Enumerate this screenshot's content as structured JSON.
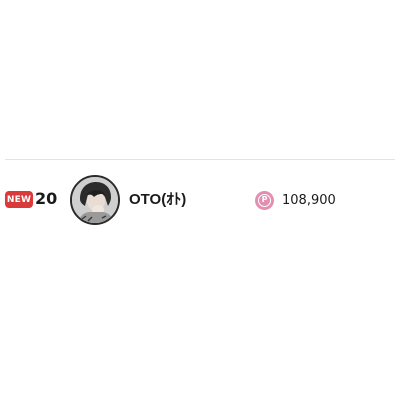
{
  "ranking_item": {
    "badge": "NEW",
    "rank": "20",
    "user_name": "OTO(ｵﾄ)",
    "points": "108,900",
    "point_icon_letter": "P"
  },
  "colors": {
    "badge_bg": "#d93a3a",
    "point_icon": "#e58fb0",
    "divider": "#e3e3e3"
  }
}
